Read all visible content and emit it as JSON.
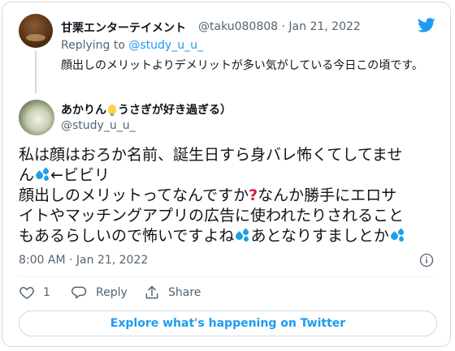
{
  "parent_tweet": {
    "display_name": "甘栗エンターテイメント",
    "handle_and_date": "@taku080808 · Jan 21, 2022",
    "replying_to_label": "Replying to",
    "replying_to_handle": "@study_u_u_",
    "text": "顔出しのメリットよりデメリットが多い気がしている今日この頃です。"
  },
  "tweet": {
    "display_name_part1": "あかりん",
    "display_name_part2": "うさぎが好き過ぎる）",
    "handle": "@study_u_u_",
    "line1": "私は顔はおろか名前、誕生日すら身バレ怖くてしてませ",
    "line2a": "ん",
    "line2b": "←ビビリ",
    "line3a": "顔出しのメリットってなんですか",
    "line3b": "なんか勝手にエロサ",
    "line4": "イトやマッチングアプリの広告に使われたりされること",
    "line5": "もあるらしいので怖いですよね",
    "line5b": "あとなりすましとか",
    "timestamp": "8:00 AM · Jan 21, 2022"
  },
  "actions": {
    "like_count": "1",
    "reply_label": "Reply",
    "share_label": "Share"
  },
  "explore_label": "Explore what's happening on Twitter",
  "icons": [
    "twitter-bird-icon",
    "info-icon",
    "heart-icon",
    "reply-icon",
    "share-icon",
    "sweat-drops-emoji",
    "light-bulb-emoji",
    "red-question-mark-emoji"
  ],
  "colors": {
    "accent": "#1d9bf0",
    "text": "#0f1419",
    "muted": "#536471",
    "border": "#cfd9de"
  }
}
